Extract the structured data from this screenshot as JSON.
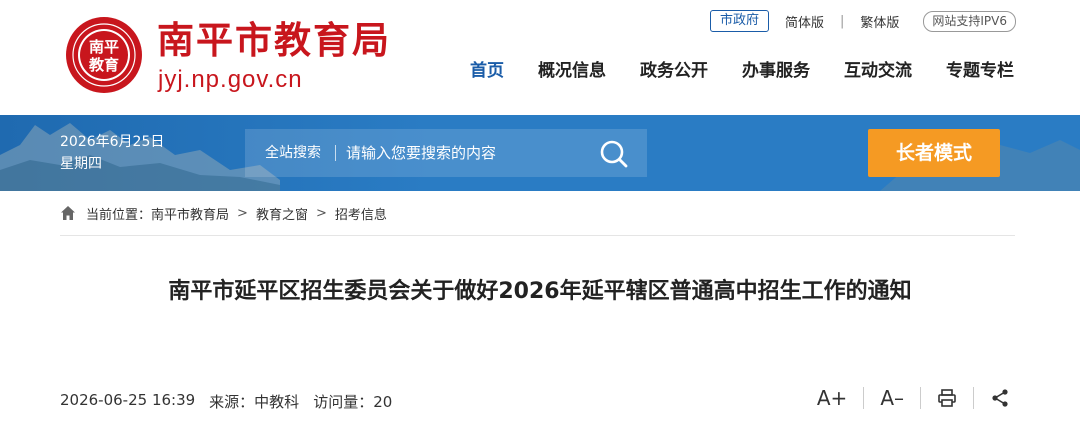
{
  "header": {
    "site_name": "南平市教育局",
    "site_domain": "jyj.np.gov.cn",
    "logo_text_top": "南平",
    "logo_text_bottom": "教育",
    "top_links": {
      "gov": "市政府",
      "simplified": "简体版",
      "divider": "|",
      "traditional": "繁体版",
      "ipv6": "网站支持IPV6"
    },
    "nav": [
      {
        "label": "首页",
        "active": true
      },
      {
        "label": "概况信息",
        "active": false
      },
      {
        "label": "政务公开",
        "active": false
      },
      {
        "label": "办事服务",
        "active": false
      },
      {
        "label": "互动交流",
        "active": false
      },
      {
        "label": "专题专栏",
        "active": false
      }
    ]
  },
  "banner": {
    "date": "2026年6月25日",
    "weekday": "星期四",
    "search_label": "全站搜索",
    "search_placeholder": "请输入您要搜索的内容",
    "elder_mode": "长者模式"
  },
  "breadcrumb": {
    "prefix": "当前位置：",
    "items": [
      "南平市教育局",
      "教育之窗",
      "招考信息"
    ],
    "separator": ">"
  },
  "article": {
    "title": "南平市延平区招生委员会关于做好2026年延平辖区普通高中招生工作的通知",
    "datetime": "2026-06-25 16:39",
    "source": "来源：中教科",
    "views": "访问量：20"
  },
  "tools": {
    "font_increase": "A+",
    "font_decrease": "A–"
  },
  "colors": {
    "brand_red": "#c8161d",
    "brand_blue": "#1a5ca8",
    "banner_blue": "#2a7cc4",
    "elder_orange": "#f59a23"
  }
}
